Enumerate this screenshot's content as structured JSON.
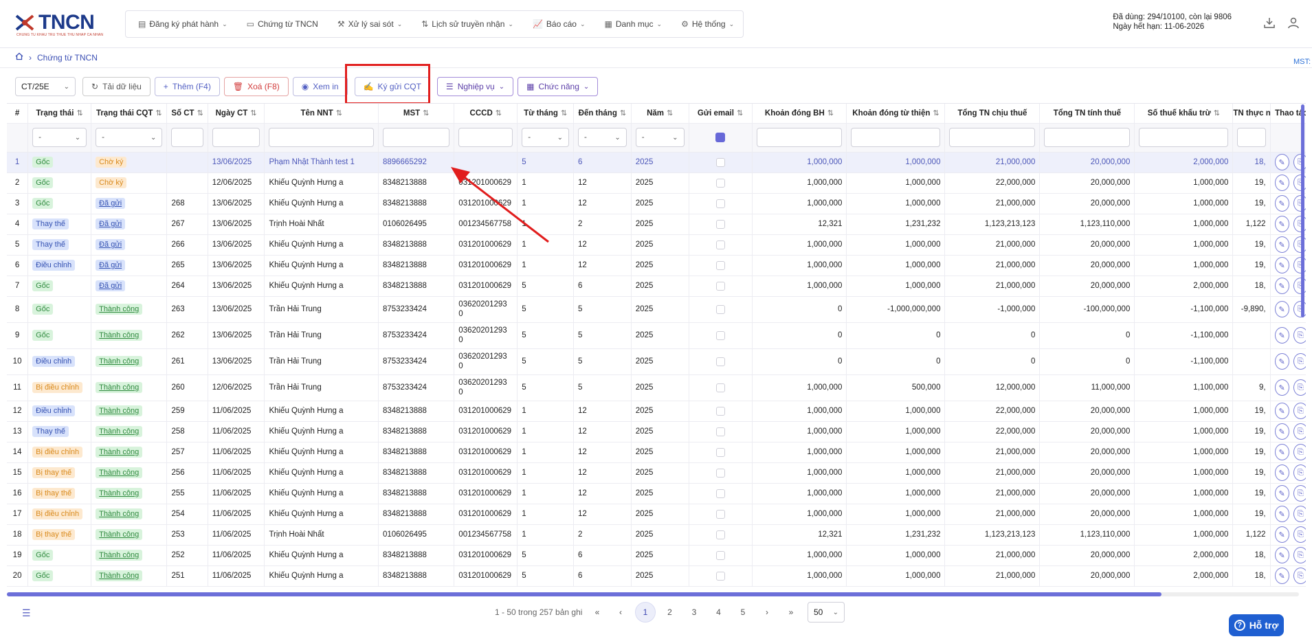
{
  "logo": {
    "text": "TNCN",
    "sub": "CHUNG TU KHAU TRU THUE THU NHAP CA NHAN"
  },
  "menu": [
    {
      "icon": "file-icon",
      "label": "Đăng ký phát hành",
      "chev": true
    },
    {
      "icon": "document-icon",
      "label": "Chứng từ TNCN",
      "chev": false
    },
    {
      "icon": "fix-icon",
      "label": "Xử lý sai sót",
      "chev": true
    },
    {
      "icon": "transfer-icon",
      "label": "Lịch sử truyền nhận",
      "chev": true
    },
    {
      "icon": "report-icon",
      "label": "Báo cáo",
      "chev": true
    },
    {
      "icon": "grid-icon",
      "label": "Danh mục",
      "chev": true
    },
    {
      "icon": "gear-icon",
      "label": "Hệ thống",
      "chev": true
    }
  ],
  "account": {
    "usage": "Đã dùng: 294/10100, còn lại 9806",
    "expiry": "Ngày hết hạn: 11-06-2026"
  },
  "breadcrumb": {
    "current": "Chứng từ TNCN"
  },
  "mst_label": "MST:",
  "toolbar": {
    "template": "CT/25E",
    "reload": "Tải dữ liệu",
    "add": "Thêm (F4)",
    "delete": "Xoá (F8)",
    "view": "Xem in",
    "sign": "Ký gửi CQT",
    "business": "Nghiệp vụ",
    "functions": "Chức năng"
  },
  "columns": [
    "#",
    "Trạng thái",
    "Trạng thái CQT",
    "Số CT",
    "Ngày CT",
    "Tên NNT",
    "MST",
    "CCCD",
    "Từ tháng",
    "Đến tháng",
    "Năm",
    "Gửi email",
    "Khoản đóng BH",
    "Khoản đóng từ thiện",
    "Tổng TN chịu thuế",
    "Tổng TN tính thuế",
    "Số thuế khấu trừ",
    "TN thực n",
    "Thao tác"
  ],
  "filter_placeholder": "-",
  "rows": [
    {
      "idx": "1",
      "status": "Gốc",
      "sc": "green",
      "cqt": "Chờ ký",
      "cc": "orange",
      "so": "",
      "ngay": "13/06/2025",
      "ten": "Phạm Nhật Thành test 1",
      "mst": "8896665292",
      "cccd": "",
      "tu": "5",
      "den": "6",
      "nam": "2025",
      "bh": "1,000,000",
      "tt": "1,000,000",
      "chiu": "21,000,000",
      "tinh": "20,000,000",
      "khau": "2,000,000",
      "thuc": "18,"
    },
    {
      "idx": "2",
      "status": "Gốc",
      "sc": "green",
      "cqt": "Chờ ký",
      "cc": "orange",
      "so": "",
      "ngay": "12/06/2025",
      "ten": "Khiếu Quỳnh Hưng a",
      "mst": "8348213888",
      "cccd": "031201000629",
      "tu": "1",
      "den": "12",
      "nam": "2025",
      "bh": "1,000,000",
      "tt": "1,000,000",
      "chiu": "22,000,000",
      "tinh": "20,000,000",
      "khau": "1,000,000",
      "thuc": "19,"
    },
    {
      "idx": "3",
      "status": "Gốc",
      "sc": "green",
      "cqt": "Đã gửi",
      "cc": "blue",
      "so": "268",
      "ngay": "13/06/2025",
      "ten": "Khiếu Quỳnh Hưng a",
      "mst": "8348213888",
      "cccd": "031201000629",
      "tu": "1",
      "den": "12",
      "nam": "2025",
      "bh": "1,000,000",
      "tt": "1,000,000",
      "chiu": "21,000,000",
      "tinh": "20,000,000",
      "khau": "1,000,000",
      "thuc": "19,"
    },
    {
      "idx": "4",
      "status": "Thay thế",
      "sc": "blue",
      "cqt": "Đã gửi",
      "cc": "blue",
      "so": "267",
      "ngay": "13/06/2025",
      "ten": "Trịnh Hoài Nhất",
      "mst": "0106026495",
      "cccd": "001234567758",
      "tu": "1",
      "den": "2",
      "nam": "2025",
      "bh": "12,321",
      "tt": "1,231,232",
      "chiu": "1,123,213,123",
      "tinh": "1,123,110,000",
      "khau": "1,000,000",
      "thuc": "1,122"
    },
    {
      "idx": "5",
      "status": "Thay thế",
      "sc": "blue",
      "cqt": "Đã gửi",
      "cc": "blue",
      "so": "266",
      "ngay": "13/06/2025",
      "ten": "Khiếu Quỳnh Hưng a",
      "mst": "8348213888",
      "cccd": "031201000629",
      "tu": "1",
      "den": "12",
      "nam": "2025",
      "bh": "1,000,000",
      "tt": "1,000,000",
      "chiu": "21,000,000",
      "tinh": "20,000,000",
      "khau": "1,000,000",
      "thuc": "19,"
    },
    {
      "idx": "6",
      "status": "Điều chỉnh",
      "sc": "blue",
      "cqt": "Đã gửi",
      "cc": "blue",
      "so": "265",
      "ngay": "13/06/2025",
      "ten": "Khiếu Quỳnh Hưng a",
      "mst": "8348213888",
      "cccd": "031201000629",
      "tu": "1",
      "den": "12",
      "nam": "2025",
      "bh": "1,000,000",
      "tt": "1,000,000",
      "chiu": "21,000,000",
      "tinh": "20,000,000",
      "khau": "1,000,000",
      "thuc": "19,"
    },
    {
      "idx": "7",
      "status": "Gốc",
      "sc": "green",
      "cqt": "Đã gửi",
      "cc": "blue",
      "so": "264",
      "ngay": "13/06/2025",
      "ten": "Khiếu Quỳnh Hưng a",
      "mst": "8348213888",
      "cccd": "031201000629",
      "tu": "5",
      "den": "6",
      "nam": "2025",
      "bh": "1,000,000",
      "tt": "1,000,000",
      "chiu": "21,000,000",
      "tinh": "20,000,000",
      "khau": "2,000,000",
      "thuc": "18,"
    },
    {
      "idx": "8",
      "status": "Gốc",
      "sc": "green",
      "cqt": "Thành công",
      "cc": "green",
      "so": "263",
      "ngay": "13/06/2025",
      "ten": "Trần Hải Trung",
      "mst": "8753233424",
      "cccd": "03620201293 0",
      "tu": "5",
      "den": "5",
      "nam": "2025",
      "bh": "0",
      "tt": "-1,000,000,000",
      "chiu": "-1,000,000",
      "tinh": "-100,000,000",
      "khau": "-1,100,000",
      "thuc": "-9,890,",
      "tall": true
    },
    {
      "idx": "9",
      "status": "Gốc",
      "sc": "green",
      "cqt": "Thành công",
      "cc": "green",
      "so": "262",
      "ngay": "13/06/2025",
      "ten": "Trần Hải Trung",
      "mst": "8753233424",
      "cccd": "03620201293 0",
      "tu": "5",
      "den": "5",
      "nam": "2025",
      "bh": "0",
      "tt": "0",
      "chiu": "0",
      "tinh": "0",
      "khau": "-1,100,000",
      "thuc": "",
      "tall": true
    },
    {
      "idx": "10",
      "status": "Điều chỉnh",
      "sc": "blue",
      "cqt": "Thành công",
      "cc": "green",
      "so": "261",
      "ngay": "13/06/2025",
      "ten": "Trần Hải Trung",
      "mst": "8753233424",
      "cccd": "03620201293 0",
      "tu": "5",
      "den": "5",
      "nam": "2025",
      "bh": "0",
      "tt": "0",
      "chiu": "0",
      "tinh": "0",
      "khau": "-1,100,000",
      "thuc": "",
      "tall": true
    },
    {
      "idx": "11",
      "status": "Bị điều chỉnh",
      "sc": "orange",
      "cqt": "Thành công",
      "cc": "green",
      "so": "260",
      "ngay": "12/06/2025",
      "ten": "Trần Hải Trung",
      "mst": "8753233424",
      "cccd": "03620201293 0",
      "tu": "5",
      "den": "5",
      "nam": "2025",
      "bh": "1,000,000",
      "tt": "500,000",
      "chiu": "12,000,000",
      "tinh": "11,000,000",
      "khau": "1,100,000",
      "thuc": "9,",
      "tall": true
    },
    {
      "idx": "12",
      "status": "Điều chỉnh",
      "sc": "blue",
      "cqt": "Thành công",
      "cc": "green",
      "so": "259",
      "ngay": "11/06/2025",
      "ten": "Khiếu Quỳnh Hưng a",
      "mst": "8348213888",
      "cccd": "031201000629",
      "tu": "1",
      "den": "12",
      "nam": "2025",
      "bh": "1,000,000",
      "tt": "1,000,000",
      "chiu": "22,000,000",
      "tinh": "20,000,000",
      "khau": "1,000,000",
      "thuc": "19,"
    },
    {
      "idx": "13",
      "status": "Thay thế",
      "sc": "blue",
      "cqt": "Thành công",
      "cc": "green",
      "so": "258",
      "ngay": "11/06/2025",
      "ten": "Khiếu Quỳnh Hưng a",
      "mst": "8348213888",
      "cccd": "031201000629",
      "tu": "1",
      "den": "12",
      "nam": "2025",
      "bh": "1,000,000",
      "tt": "1,000,000",
      "chiu": "22,000,000",
      "tinh": "20,000,000",
      "khau": "1,000,000",
      "thuc": "19,"
    },
    {
      "idx": "14",
      "status": "Bị điều chỉnh",
      "sc": "orange",
      "cqt": "Thành công",
      "cc": "green",
      "so": "257",
      "ngay": "11/06/2025",
      "ten": "Khiếu Quỳnh Hưng a",
      "mst": "8348213888",
      "cccd": "031201000629",
      "tu": "1",
      "den": "12",
      "nam": "2025",
      "bh": "1,000,000",
      "tt": "1,000,000",
      "chiu": "21,000,000",
      "tinh": "20,000,000",
      "khau": "1,000,000",
      "thuc": "19,"
    },
    {
      "idx": "15",
      "status": "Bị thay thế",
      "sc": "orange",
      "cqt": "Thành công",
      "cc": "green",
      "so": "256",
      "ngay": "11/06/2025",
      "ten": "Khiếu Quỳnh Hưng a",
      "mst": "8348213888",
      "cccd": "031201000629",
      "tu": "1",
      "den": "12",
      "nam": "2025",
      "bh": "1,000,000",
      "tt": "1,000,000",
      "chiu": "21,000,000",
      "tinh": "20,000,000",
      "khau": "1,000,000",
      "thuc": "19,"
    },
    {
      "idx": "16",
      "status": "Bị thay thế",
      "sc": "orange",
      "cqt": "Thành công",
      "cc": "green",
      "so": "255",
      "ngay": "11/06/2025",
      "ten": "Khiếu Quỳnh Hưng a",
      "mst": "8348213888",
      "cccd": "031201000629",
      "tu": "1",
      "den": "12",
      "nam": "2025",
      "bh": "1,000,000",
      "tt": "1,000,000",
      "chiu": "21,000,000",
      "tinh": "20,000,000",
      "khau": "1,000,000",
      "thuc": "19,"
    },
    {
      "idx": "17",
      "status": "Bị điều chỉnh",
      "sc": "orange",
      "cqt": "Thành công",
      "cc": "green",
      "so": "254",
      "ngay": "11/06/2025",
      "ten": "Khiếu Quỳnh Hưng a",
      "mst": "8348213888",
      "cccd": "031201000629",
      "tu": "1",
      "den": "12",
      "nam": "2025",
      "bh": "1,000,000",
      "tt": "1,000,000",
      "chiu": "21,000,000",
      "tinh": "20,000,000",
      "khau": "1,000,000",
      "thuc": "19,"
    },
    {
      "idx": "18",
      "status": "Bị thay thế",
      "sc": "orange",
      "cqt": "Thành công",
      "cc": "green",
      "so": "253",
      "ngay": "11/06/2025",
      "ten": "Trịnh Hoài Nhất",
      "mst": "0106026495",
      "cccd": "001234567758",
      "tu": "1",
      "den": "2",
      "nam": "2025",
      "bh": "12,321",
      "tt": "1,231,232",
      "chiu": "1,123,213,123",
      "tinh": "1,123,110,000",
      "khau": "1,000,000",
      "thuc": "1,122"
    },
    {
      "idx": "19",
      "status": "Gốc",
      "sc": "green",
      "cqt": "Thành công",
      "cc": "green",
      "so": "252",
      "ngay": "11/06/2025",
      "ten": "Khiếu Quỳnh Hưng a",
      "mst": "8348213888",
      "cccd": "031201000629",
      "tu": "5",
      "den": "6",
      "nam": "2025",
      "bh": "1,000,000",
      "tt": "1,000,000",
      "chiu": "21,000,000",
      "tinh": "20,000,000",
      "khau": "2,000,000",
      "thuc": "18,"
    },
    {
      "idx": "20",
      "status": "Gốc",
      "sc": "green",
      "cqt": "Thành công",
      "cc": "green",
      "so": "251",
      "ngay": "11/06/2025",
      "ten": "Khiếu Quỳnh Hưng a",
      "mst": "8348213888",
      "cccd": "031201000629",
      "tu": "5",
      "den": "6",
      "nam": "2025",
      "bh": "1,000,000",
      "tt": "1,000,000",
      "chiu": "21,000,000",
      "tinh": "20,000,000",
      "khau": "2,000,000",
      "thuc": "18,"
    }
  ],
  "pagination": {
    "info": "1 - 50 trong 257 bản ghi",
    "pages": [
      "1",
      "2",
      "3",
      "4",
      "5"
    ],
    "current": "1",
    "page_size": "50"
  },
  "help": {
    "label": "Hỗ trợ"
  },
  "colors": {
    "accent": "#5b5fc7",
    "highlight": "#e11d1d",
    "help": "#1f5fd1"
  }
}
